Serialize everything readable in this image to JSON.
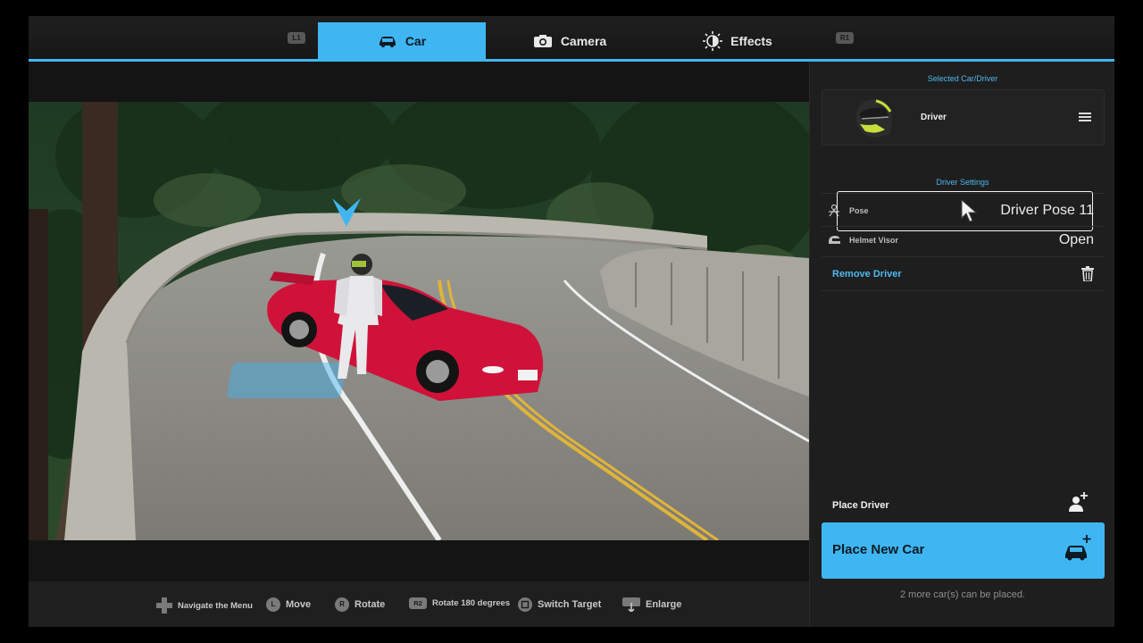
{
  "tabs": {
    "left_shoulder": "L1",
    "right_shoulder": "R1",
    "items": [
      {
        "label": "Car",
        "icon": "car-icon",
        "active": true
      },
      {
        "label": "Camera",
        "icon": "camera-icon",
        "active": false
      },
      {
        "label": "Effects",
        "icon": "brightness-icon",
        "active": false
      }
    ]
  },
  "panel": {
    "selected_title": "Selected Car/Driver",
    "selected_item": {
      "label": "Driver",
      "thumbnail": "helmet-image"
    },
    "settings_title": "Driver Settings",
    "settings": [
      {
        "label": "Pose",
        "value": "Driver Pose 11",
        "icon": "pose-icon",
        "selected": true
      },
      {
        "label": "Helmet Visor",
        "value": "Open",
        "icon": "visor-icon",
        "selected": false
      }
    ],
    "remove_label": "Remove Driver",
    "place_driver_label": "Place Driver",
    "place_car_label": "Place New Car",
    "cars_remaining": "2 more car(s) can be placed."
  },
  "hints": [
    {
      "button": "dpad-icon",
      "label": "Navigate the Menu"
    },
    {
      "button": "L",
      "label": "Move"
    },
    {
      "button": "R",
      "label": "Rotate"
    },
    {
      "button": "R2",
      "label": "Rotate 180 degrees"
    },
    {
      "button": "square-button-icon",
      "label": "Switch Target"
    },
    {
      "button": "touchpad-icon",
      "label": "Enlarge"
    }
  ],
  "colors": {
    "accent": "#3fb6f2",
    "car_body": "#d0123a",
    "panel_bg": "#1e1e1e"
  }
}
